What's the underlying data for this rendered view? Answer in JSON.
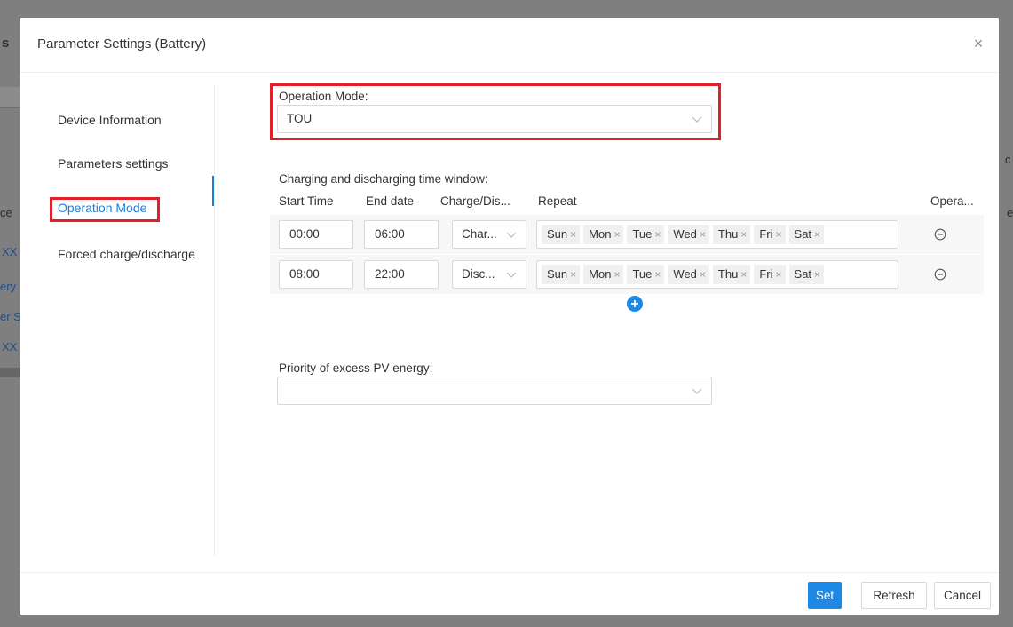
{
  "background": {
    "fragments": [
      "s",
      "ce",
      "XX",
      "ery",
      "er S",
      "XX"
    ],
    "right_fragments": [
      "c",
      "e"
    ]
  },
  "modal": {
    "title": "Parameter Settings (Battery)",
    "close_glyph": "×"
  },
  "sidebar": {
    "items": [
      {
        "label": "Device Information"
      },
      {
        "label": "Parameters settings"
      },
      {
        "label": "Operation Mode",
        "active": true
      },
      {
        "label": "Forced charge/discharge"
      }
    ]
  },
  "form": {
    "operation_mode_label": "Operation Mode:",
    "operation_mode_value": "TOU",
    "time_window_label": "Charging and discharging time window:",
    "columns": [
      "Start Time",
      "End date",
      "Charge/Dis...",
      "Repeat",
      "Opera..."
    ],
    "rows": [
      {
        "start": "00:00",
        "end": "06:00",
        "mode": "Char...",
        "days": [
          "Sun",
          "Mon",
          "Tue",
          "Wed",
          "Thu",
          "Fri",
          "Sat"
        ]
      },
      {
        "start": "08:00",
        "end": "22:00",
        "mode": "Disc...",
        "days": [
          "Sun",
          "Mon",
          "Tue",
          "Wed",
          "Thu",
          "Fri",
          "Sat"
        ]
      }
    ],
    "pv_priority_label": "Priority of excess PV energy:",
    "pv_priority_value": ""
  },
  "footer": {
    "set_label": "Set",
    "refresh_label": "Refresh",
    "cancel_label": "Cancel"
  },
  "colors": {
    "accent": "#1e88e5",
    "highlight_box": "#e0202a"
  }
}
